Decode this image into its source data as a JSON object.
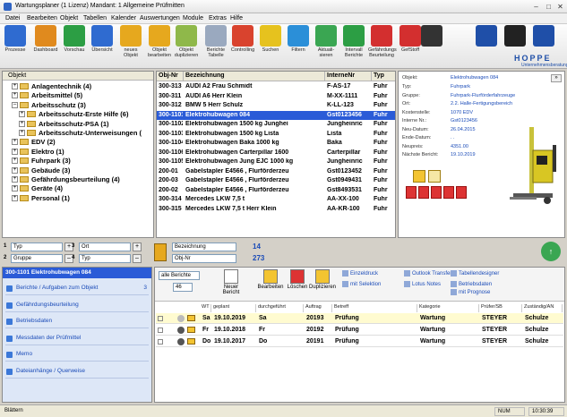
{
  "window": {
    "title": "Wartungsplaner  (1 Lizenz)   Mandant: 1 Allgemeine Prüfmitten",
    "controls": [
      "–",
      "□",
      "✕"
    ]
  },
  "menu": [
    "Datei",
    "Bearbeiten",
    "Objekt",
    "Tabellen",
    "Kalender",
    "Auswertungen",
    "Module",
    "Extras",
    "Hilfe"
  ],
  "toolbar": [
    {
      "label": "Prozesse",
      "icon": "process-icon",
      "color": "#2f6bd0"
    },
    {
      "label": "Dashboard",
      "icon": "dashboard-icon",
      "color": "#e08a1e"
    },
    {
      "label": "Vorschau",
      "icon": "preview-icon",
      "color": "#2c9e44"
    },
    {
      "label": "Übersicht",
      "icon": "overview-icon",
      "color": "#2f6bd0"
    },
    {
      "label": "neues Objekt",
      "icon": "new-object-icon",
      "color": "#e6a81e"
    },
    {
      "label": "Objekt bearbeiten",
      "icon": "edit-object-icon",
      "color": "#e6a81e"
    },
    {
      "label": "Objekt duplizieren",
      "icon": "duplicate-object-icon",
      "color": "#8fb84a"
    },
    {
      "label": "Berichte Tabelle",
      "icon": "report-table-icon",
      "color": "#9aa9bf"
    },
    {
      "label": "Controlling",
      "icon": "controlling-icon",
      "color": "#d9432e"
    },
    {
      "label": "Suchen",
      "icon": "search-icon",
      "color": "#e6c21e"
    },
    {
      "label": "Filtern",
      "icon": "filter-icon",
      "color": "#2b8fd8"
    },
    {
      "label": "Aktuali-sieren",
      "icon": "refresh-icon",
      "color": "#3aa652"
    },
    {
      "label": "Intervall Berichte",
      "icon": "interval-report-icon",
      "color": "#2c9e44"
    },
    {
      "label": "Gefährdungs Beurteilung",
      "icon": "hazard-icon",
      "color": "#d32f2f"
    },
    {
      "label": "GefStoff",
      "icon": "hazmat-icon",
      "color": "#d32f2f"
    },
    {
      "label": "",
      "icon": "phone-icon",
      "color": "#333333"
    },
    {
      "label": "",
      "icon": "rfid-icon",
      "color": "#1f4fa8"
    },
    {
      "label": "",
      "icon": "camera-icon",
      "color": "#222222"
    },
    {
      "label": "",
      "icon": "help-icon",
      "color": "#1f4fa8"
    }
  ],
  "brand": {
    "name": "HOPPE",
    "sub": "Unternehmensberatung"
  },
  "tree": {
    "header": "Objekt",
    "items": [
      {
        "label": "Anlagentechnik  (4)",
        "level": 0,
        "exp": "+"
      },
      {
        "label": "Arbeitsmittel  (5)",
        "level": 0,
        "exp": "+"
      },
      {
        "label": "Arbeitsschutz  (3)",
        "level": 0,
        "exp": "–"
      },
      {
        "label": "Arbeitsschutz-Erste Hilfe  (6)",
        "level": 1,
        "exp": "+"
      },
      {
        "label": "Arbeitsschutz-PSA  (1)",
        "level": 1,
        "exp": "+"
      },
      {
        "label": "Arbeitsschutz-Unterweisungen  (",
        "level": 1,
        "exp": "+"
      },
      {
        "label": "EDV  (2)",
        "level": 0,
        "exp": "+"
      },
      {
        "label": "Elektro  (1)",
        "level": 0,
        "exp": "+"
      },
      {
        "label": "Fuhrpark  (3)",
        "level": 0,
        "exp": "+"
      },
      {
        "label": "Gebäude  (3)",
        "level": 0,
        "exp": "+"
      },
      {
        "label": "Gefährdungsbeurteilung  (4)",
        "level": 0,
        "exp": "+"
      },
      {
        "label": "Geräte  (4)",
        "level": 0,
        "exp": "+"
      },
      {
        "label": "Personal  (1)",
        "level": 0,
        "exp": "+"
      }
    ]
  },
  "grid": {
    "columns": [
      "Obj-Nr",
      "Bezeichnung",
      "InterneNr",
      "Typ"
    ],
    "rows": [
      [
        "300-313",
        "AUDI A2 Frau Schmidt",
        "F-AS-17",
        "Fuhr"
      ],
      [
        "300-311",
        "AUDI A6 Herr Klein",
        "M-XX-1111",
        "Fuhr"
      ],
      [
        "300-312",
        "BMW 5 Herr Schulz",
        "K-LL-123",
        "Fuhr"
      ],
      [
        "300-1101",
        "Elektrohubwagen 084",
        "Gst0123456",
        "Fuhr"
      ],
      [
        "300-1102",
        "Elektrohubwagen 1500 kg  Junghei",
        "Jungheinric",
        "Fuhr"
      ],
      [
        "300-1103",
        "Elektrohubwagen 1500 kg Lista",
        "Lista",
        "Fuhr"
      ],
      [
        "300-1104",
        "Elektrohubwagen Baka 1000 kg",
        "Baka",
        "Fuhr"
      ],
      [
        "300-1106",
        "Elektrohubwagen Carterpillar 1600",
        "Carterpillar",
        "Fuhr"
      ],
      [
        "300-1105",
        "Elektrohubwagen Jung EJC 1000 kg",
        "Jungheinric",
        "Fuhr"
      ],
      [
        "200-01",
        "Gabelstapler E4566 , Flurförderzeu",
        "Gst0123452",
        "Fuhr"
      ],
      [
        "200-03",
        "Gabelstapler E4566 , Flurförderzeu",
        "Gst0949431",
        "Fuhr"
      ],
      [
        "200-02",
        "Gabelstapler E4566 , Flurförderzeu",
        "Gst8493531",
        "Fuhr"
      ],
      [
        "300-314",
        "Mercedes LKW 7,5 t",
        "AA-XX-100",
        "Fuhr"
      ],
      [
        "300-315",
        "Mercedes LKW 7,5 t Herr Klein",
        "AA-KR-100",
        "Fuhr"
      ]
    ],
    "selected": 3
  },
  "detail": {
    "rows": [
      [
        "Objekt:",
        "Elektrohubwagen 084"
      ],
      [
        "Typ:",
        "Fuhrpark"
      ],
      [
        "Gruppe:",
        "Fuhrpark-Flurförderfahrzeuge"
      ],
      [
        "Ort:",
        "2.2. Halle-Fertigungsbereich"
      ],
      [
        "Kostenstelle:",
        "1070 EDV"
      ],
      [
        "Interne Nr.:",
        "Gst0123456"
      ],
      [
        "Neu-Datum:",
        "26.04.2015"
      ],
      [
        "Ende-Datum:",
        ". ."
      ],
      [
        "Neupreis:",
        "4351.00"
      ],
      [
        "Nächste Bericht:",
        "19.10.2019"
      ]
    ]
  },
  "filters": {
    "left": [
      [
        "1",
        "Typ"
      ],
      [
        "2",
        "Gruppe"
      ],
      [
        "3",
        "Ort"
      ],
      [
        "4",
        "Typ"
      ]
    ],
    "mid": [
      "Bezeichnung",
      "Obj-Nr"
    ],
    "counts": [
      "14",
      "273"
    ]
  },
  "leftnav": {
    "title": "300-1101 Elektrohubwagen 084",
    "items": [
      [
        "Berichte / Aufgaben zum Objekt",
        "3"
      ],
      [
        "Gefährdungsbeurteilung",
        ""
      ],
      [
        "Betriebsdaten",
        ""
      ],
      [
        "Messdaten der Prüfmittel",
        ""
      ],
      [
        "Memo",
        ""
      ],
      [
        "Dateianhänge / Querweise",
        ""
      ]
    ]
  },
  "reports": {
    "filter": "alle Berichte",
    "count": "46",
    "actions": [
      "Neuer Bericht",
      "Bearbeiten",
      "Löschen",
      "Duplizieren"
    ],
    "links": [
      "Einzeldruck",
      "mit Selektion",
      "Outlook Transfer",
      "Lotus Notes",
      "Tabellendesigner",
      "Betriebsdaten",
      "mit Prognose"
    ],
    "columns": [
      "WT",
      "geplant",
      "durchgeführt",
      "Auftrag",
      "Betreff",
      "Kategorie",
      "Prüfer/SB",
      "Zuständig/AN"
    ],
    "rows": [
      [
        "Sa",
        "19.10.2019",
        "Sa",
        "20193",
        "Prüfung",
        "Wartung",
        "STEYER",
        "Schulze"
      ],
      [
        "Fr",
        "19.10.2018",
        "Fr",
        "20192",
        "Prüfung",
        "Wartung",
        "STEYER",
        "Schulze"
      ],
      [
        "Do",
        "19.10.2017",
        "Do",
        "20191",
        "Prüfung",
        "Wartung",
        "STEYER",
        "Schulze"
      ]
    ]
  },
  "status": {
    "left": "Blättern",
    "num": "NUM",
    "time": "10:30:39"
  }
}
